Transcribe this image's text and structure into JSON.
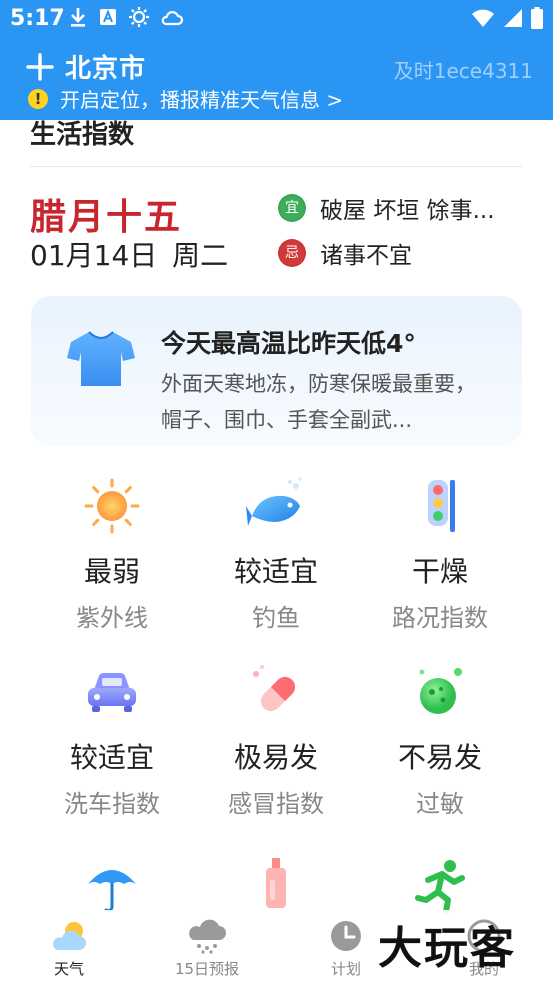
{
  "status_bar": {
    "time": "5:17"
  },
  "header": {
    "city": "北京市",
    "update_tag": "及时1ece4311",
    "locate_prompt": "开启定位，播报精准天气信息 >"
  },
  "section": {
    "title": "生活指数"
  },
  "almanac": {
    "lunar_day": "腊月十五",
    "date": "01月14日",
    "weekday": "周二",
    "yi_label": "宜",
    "yi_text": "破屋  坏垣  馀事...",
    "ji_label": "忌",
    "ji_text": "诸事不宜"
  },
  "tip": {
    "title": "今天最高温比昨天低4°",
    "description": "外面天寒地冻，防寒保暖最重要，帽子、围巾、手套全副武..."
  },
  "indices": [
    {
      "level": "最弱",
      "name": "紫外线",
      "icon": "sun-icon"
    },
    {
      "level": "较适宜",
      "name": "钓鱼",
      "icon": "fish-icon"
    },
    {
      "level": "干燥",
      "name": "路况指数",
      "icon": "traffic-light-icon"
    },
    {
      "level": "较适宜",
      "name": "洗车指数",
      "icon": "car-icon"
    },
    {
      "level": "极易发",
      "name": "感冒指数",
      "icon": "pill-icon"
    },
    {
      "level": "不易发",
      "name": "过敏",
      "icon": "allergy-icon"
    },
    {
      "level": "",
      "name": "",
      "icon": "umbrella-icon"
    },
    {
      "level": "",
      "name": "",
      "icon": "cosmetic-bottle-icon"
    },
    {
      "level": "",
      "name": "",
      "icon": "running-icon"
    }
  ],
  "bottom_nav": [
    {
      "label": "天气",
      "icon": "weather-cloud-sun-icon",
      "active": true
    },
    {
      "label": "15日预报",
      "icon": "rain-cloud-icon",
      "active": false
    },
    {
      "label": "计划",
      "icon": "clock-icon",
      "active": false
    },
    {
      "label": "我的",
      "icon": "profile-icon",
      "active": false
    }
  ],
  "watermark": "大玩客",
  "colors": {
    "header_blue": "#2b95f4",
    "lunar_red": "#c8262f",
    "yi_green": "#3fae5a",
    "ji_red": "#d23a3a"
  }
}
